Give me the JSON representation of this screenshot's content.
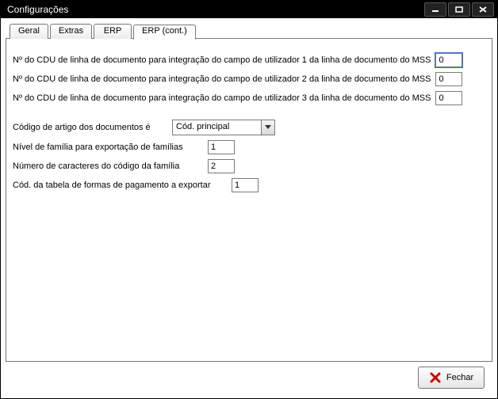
{
  "window": {
    "title": "Configurações"
  },
  "tabs": {
    "geral": "Geral",
    "extras": "Extras",
    "erp": "ERP",
    "erp_cont": "ERP (cont.)"
  },
  "fields": {
    "cdu1": {
      "label": "Nº do CDU de linha de documento para integração do campo de utilizador 1 da linha de documento do MSS",
      "value": "0"
    },
    "cdu2": {
      "label": "Nº do CDU de linha de documento para integração do campo de utilizador 2 da linha de documento do MSS",
      "value": "0"
    },
    "cdu3": {
      "label": "Nº do CDU de linha de documento para integração do campo de utilizador 3 da linha de documento do MSS",
      "value": "0"
    },
    "codigo_artigo": {
      "label": "Código de artigo dos documentos é",
      "value": "Cód. principal"
    },
    "nivel_familia": {
      "label": "Nível de família para exportação de famílias",
      "value": "1"
    },
    "num_caracteres": {
      "label": "Número de caracteres do código da família",
      "value": "2"
    },
    "cod_tabela": {
      "label": "Cód. da tabela de formas de pagamento a exportar",
      "value": "1"
    }
  },
  "buttons": {
    "close": "Fechar"
  }
}
